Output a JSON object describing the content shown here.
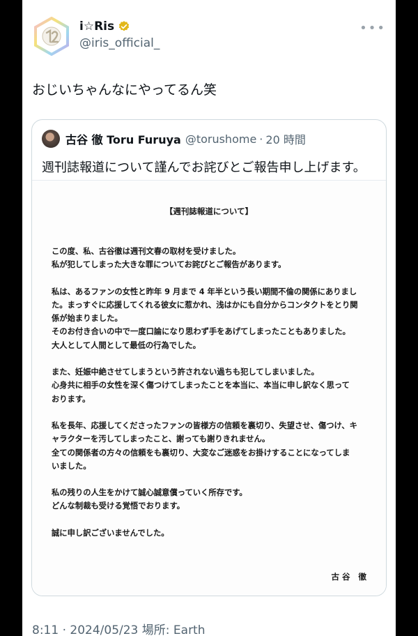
{
  "account": {
    "display_name": "i☆Ris",
    "handle": "@iris_official_",
    "more_label": "•••"
  },
  "tweet": {
    "text": "おじいちゃんなにやってるん笑",
    "footer": "8:11 · 2024/05/23 場所: Earth"
  },
  "quote": {
    "name": "古谷 徹 Toru Furuya",
    "handle": "@torushome",
    "separator": "·",
    "time": "20 時間",
    "text": "週刊誌報道について謹んでお詫びとご報告申し上げます。",
    "document": {
      "title": "【週刊誌報道について】",
      "lines": [
        "この度、私、古谷徹は週刊文春の取材を受けました。",
        "私が犯してしまった大きな罪についてお詫びとご報告があります。",
        "",
        "私は、あるファンの女性と昨年 9 月まで 4 年半という長い期間不倫の関係にありまし",
        "た。まっすぐに応援してくれる彼女に惹かれ、浅はかにも自分からコンタクトをとり関",
        "係が始まりました。",
        "そのお付き合いの中で一度口論になり思わず手をあげてしまったこともありました。",
        "大人として人間として最低の行為でした。",
        "",
        "また、妊娠中絶させてしまうという許されない過ちも犯してしまいました。",
        "心身共に相手の女性を深く傷つけてしまったことを本当に、本当に申し訳なく思って",
        "おります。",
        "",
        "私を長年、応援してくださったファンの皆様方の信頼を裏切り、失望させ、傷つけ、キ",
        "ャラクターを汚してしまったこと、謝っても謝りきれません。",
        "全ての関係者の方々の信頼をも裏切り、大変なご迷惑をお掛けすることになってしま",
        "いました。",
        "",
        "私の残りの人生をかけて誠心誠意償っていく所存です。",
        "どんな制裁も受ける覚悟でおります。",
        "",
        "誠に申し訳ございませんでした。"
      ],
      "signature": "古谷 徹"
    }
  },
  "colors": {
    "text_primary": "#0f1419",
    "text_secondary": "#536471",
    "verified_gold": "#e2b719",
    "border": "#cfd9de"
  },
  "icons": {
    "verified": "verified-badge-icon",
    "avatar": "iris-logo-avatar"
  }
}
